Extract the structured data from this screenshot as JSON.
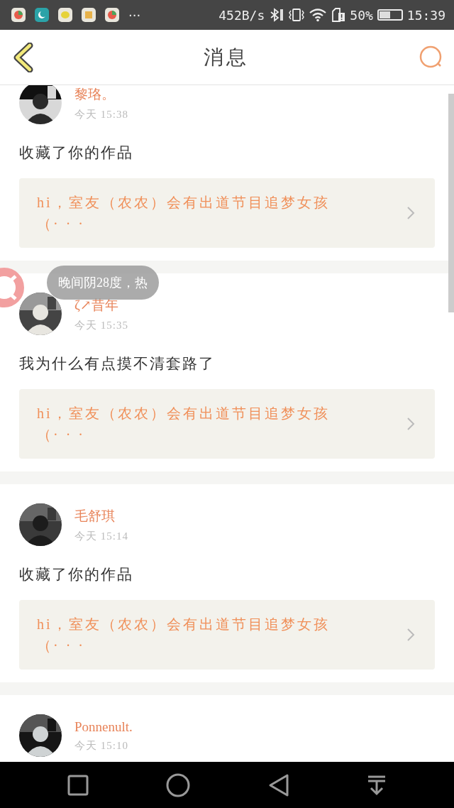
{
  "status_bar": {
    "more": "···",
    "speed": "452B/s",
    "battery": "50%",
    "time": "15:39"
  },
  "header": {
    "title": "消息"
  },
  "messages": [
    {
      "name": "黎珞。",
      "time": "今天 15:38",
      "text": "收藏了你的作品",
      "work": "hi，室友（农农）会有出道节目追梦女孩（· · ·"
    },
    {
      "name": "ζ↗昔年",
      "time": "今天 15:35",
      "text": "我为什么有点摸不清套路了",
      "work": "hi，室友（农农）会有出道节目追梦女孩（· · ·"
    },
    {
      "name": "毛舒琪",
      "time": "今天 15:14",
      "text": "收藏了你的作品",
      "work": "hi，室友（农农）会有出道节目追梦女孩（· · ·"
    },
    {
      "name": "Ponnenult.",
      "time": "今天 15:10"
    }
  ],
  "floating_bubble": {
    "text": "晚间阴28度，热"
  }
}
